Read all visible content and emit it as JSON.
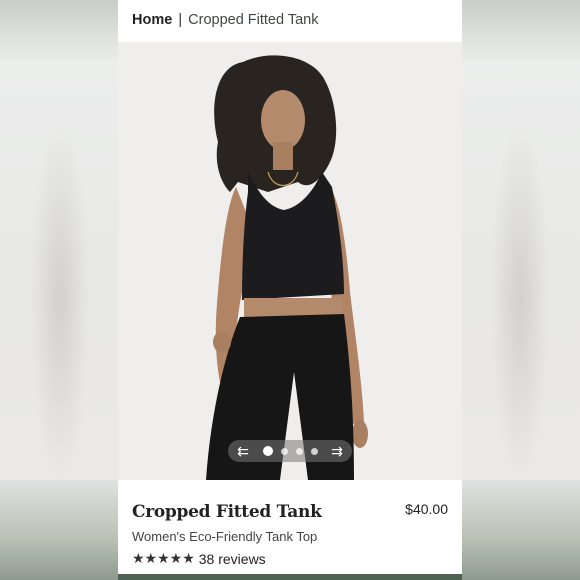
{
  "breadcrumb": {
    "home": "Home",
    "separator": "|",
    "current": "Cropped Fitted Tank"
  },
  "carousel": {
    "prev_icon": "arrow-left-icon",
    "next_icon": "arrow-right-icon",
    "prev_glyph": "⇇",
    "next_glyph": "⇉",
    "slide_count": 4,
    "active_slide": 1
  },
  "product": {
    "title": "Cropped Fitted Tank",
    "price": "$40.00",
    "subtitle": "Women's Eco-Friendly Tank Top",
    "rating": 5,
    "stars": "★★★★★",
    "reviews": "38 reviews"
  },
  "colors": {
    "accent": "#4f6150",
    "text": "#222222",
    "image_bg": "#efeeec"
  }
}
